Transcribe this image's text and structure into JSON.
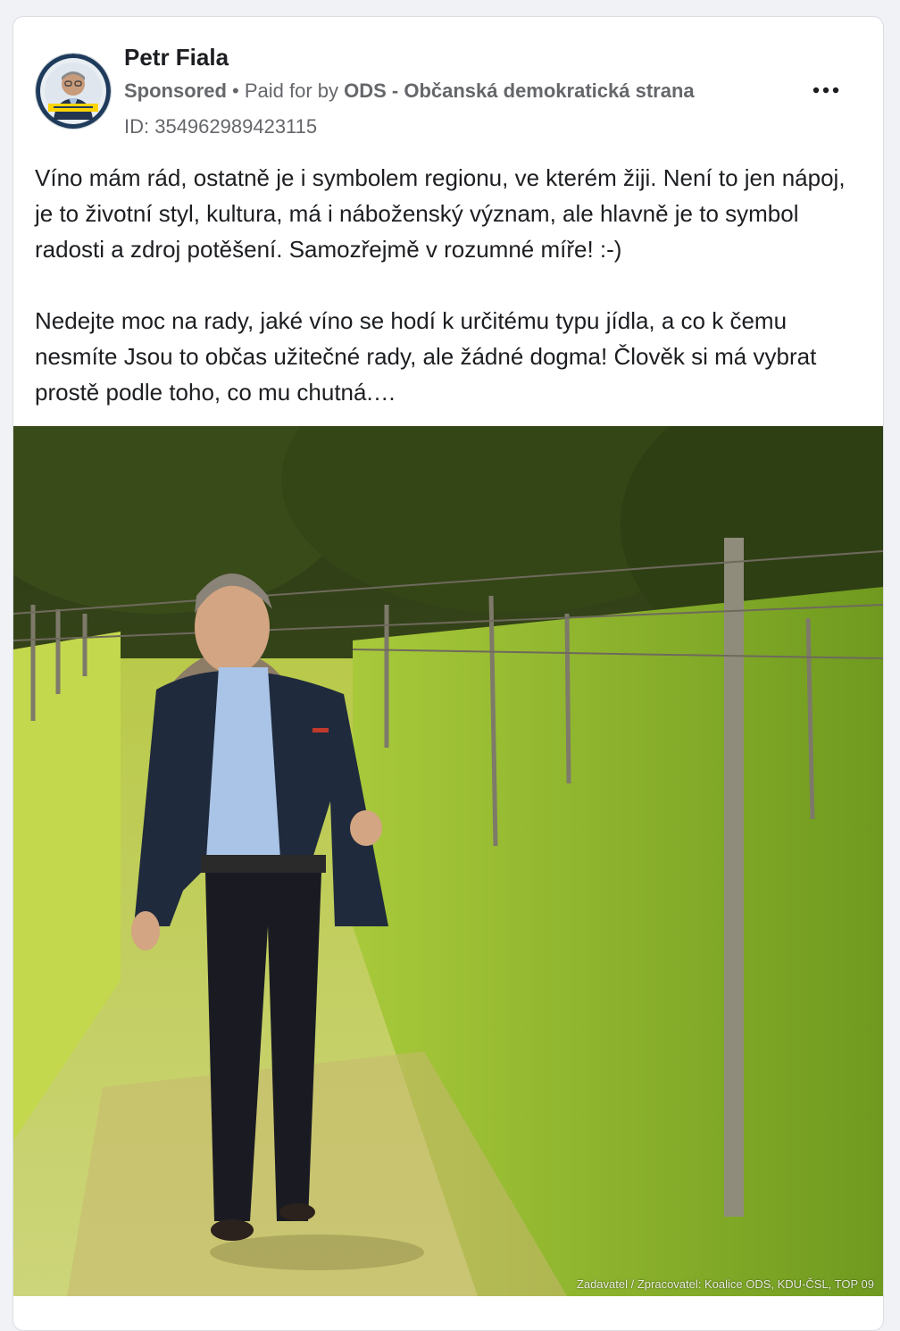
{
  "post": {
    "author": "Petr Fiala",
    "sponsored_label": "Sponsored",
    "paid_for_prefix": " • Paid for by ",
    "payer": "ODS - Občanská demokratická strana",
    "ad_id": "ID: 354962989423115",
    "more_icon": "more-horizontal-icon",
    "paragraphs": [
      "Víno mám rád, ostatně je i symbolem regionu, ve kterém žiji. Není to jen nápoj, je to životní styl, kultura, má i náboženský význam, ale hlavně je to symbol radosti a zdroj potěšení. Samozřejmě v rozumné míře! :-)",
      "Nedejte moc na rady, jaké víno se hodí k určitému typu jídla, a co k čemu nesmíte Jsou to občas užitečné rady, ale žádné dogma! Člověk si má vybrat prostě podle toho, co mu chutná.…"
    ],
    "image_credit": "Zadavatel / Zpracovatel: Koalice ODS, KDU-ČSL, TOP 09"
  },
  "colors": {
    "card_bg": "#ffffff",
    "text_primary": "#1c1e21",
    "text_secondary": "#65676b",
    "avatar_ring": "#1f3b5c",
    "avatar_banner": "#ffd400"
  }
}
